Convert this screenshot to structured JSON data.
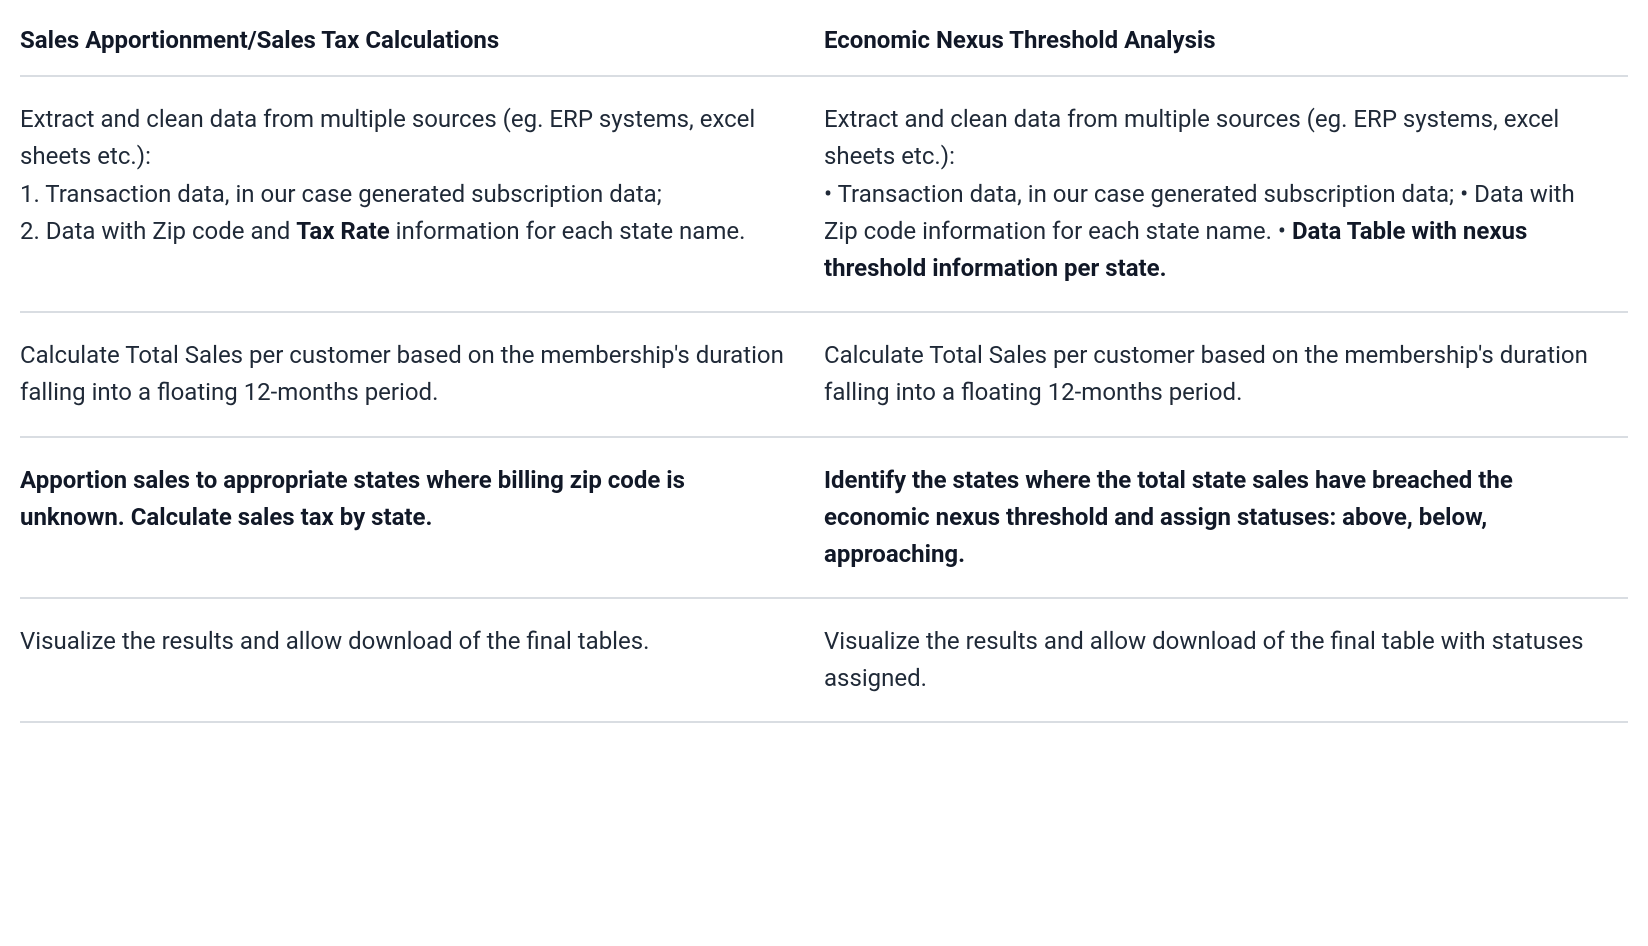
{
  "table": {
    "head": {
      "colA": "Sales Apportionment/Sales Tax Calculations",
      "colB": "Economic Nexus Threshold Analysis"
    },
    "rows": [
      {
        "a": {
          "intro": "Extract and clean data from multiple sources (eg. ERP systems, excel sheets etc.):",
          "item1": "1. Transaction data, in our case generated subscription data;",
          "item2_pre": "2. Data with Zip code and ",
          "item2_bold": "Tax Rate",
          "item2_post": " information for each state name."
        },
        "b": {
          "intro": "Extract and clean data from multiple sources (eg. ERP systems, excel sheets etc.):",
          "item1": "Transaction data, in our case generated subscription data;",
          "item2": "Data with Zip code information for each state name.",
          "item3_bold": "Data Table with nexus threshold information per state."
        }
      },
      {
        "a": "Calculate Total Sales per customer based on the membership's duration falling into a floating 12-months period.",
        "b": "Calculate Total Sales per customer based on the membership's duration falling into a floating 12-months period."
      },
      {
        "a_bold": "Apportion sales to appropriate states where billing zip code is unknown. Calculate sales tax by state.",
        "b_bold": "Identify the states where the total state sales have breached the economic nexus threshold and assign statuses: above, below, approaching."
      },
      {
        "a": "Visualize the results and allow download of the final tables.",
        "b": "Visualize the results and allow download of the final table with statuses assigned."
      }
    ]
  }
}
